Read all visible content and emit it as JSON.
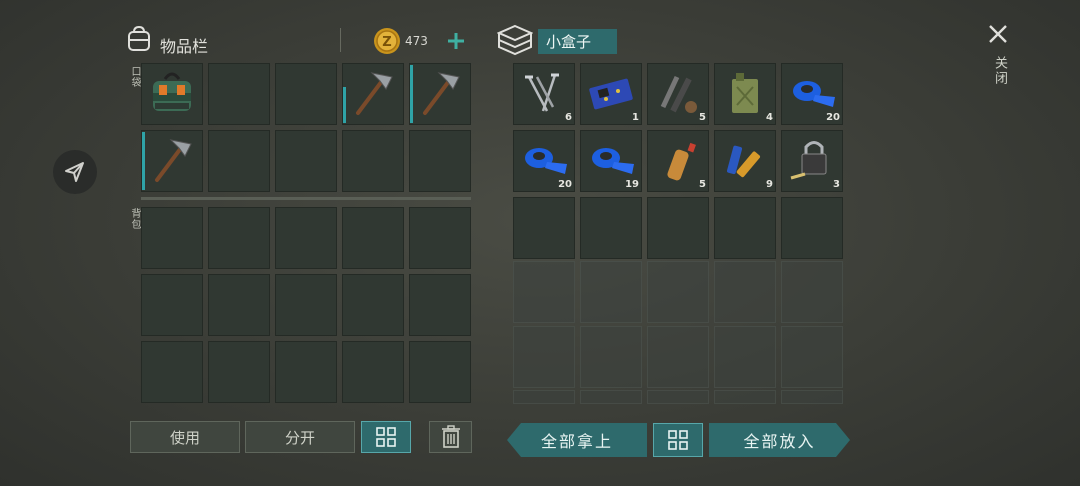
{
  "inventory": {
    "title": "物品栏",
    "coins": "473",
    "pocket_label": "口袋",
    "backpack_label": "背包",
    "pocket_slots": [
      {
        "item": "toolbox-bag"
      },
      {
        "item": ""
      },
      {
        "item": ""
      },
      {
        "item": "pickaxe"
      },
      {
        "item": "pickaxe"
      },
      {
        "item": "pickaxe"
      },
      {
        "item": ""
      },
      {
        "item": ""
      },
      {
        "item": ""
      },
      {
        "item": ""
      }
    ]
  },
  "container": {
    "title": "小盒子",
    "slots": [
      {
        "item": "nails",
        "qty": "6"
      },
      {
        "item": "circuit-board",
        "qty": "1"
      },
      {
        "item": "pipe-parts",
        "qty": "5"
      },
      {
        "item": "jerrycan",
        "qty": "4"
      },
      {
        "item": "duct-tape",
        "qty": "20"
      },
      {
        "item": "duct-tape",
        "qty": "20"
      },
      {
        "item": "duct-tape",
        "qty": "19"
      },
      {
        "item": "plastic-bottle",
        "qty": "5"
      },
      {
        "item": "batteries",
        "qty": "9"
      },
      {
        "item": "padlock",
        "qty": "3"
      }
    ]
  },
  "buttons": {
    "use": "使用",
    "split": "分开",
    "take_all": "全部拿上",
    "put_all": "全部放入"
  },
  "close_label": "关闭",
  "colors": {
    "accent": "#2e6a6c",
    "accent_border": "#57a7aa",
    "durability": "#2fa3a7"
  }
}
